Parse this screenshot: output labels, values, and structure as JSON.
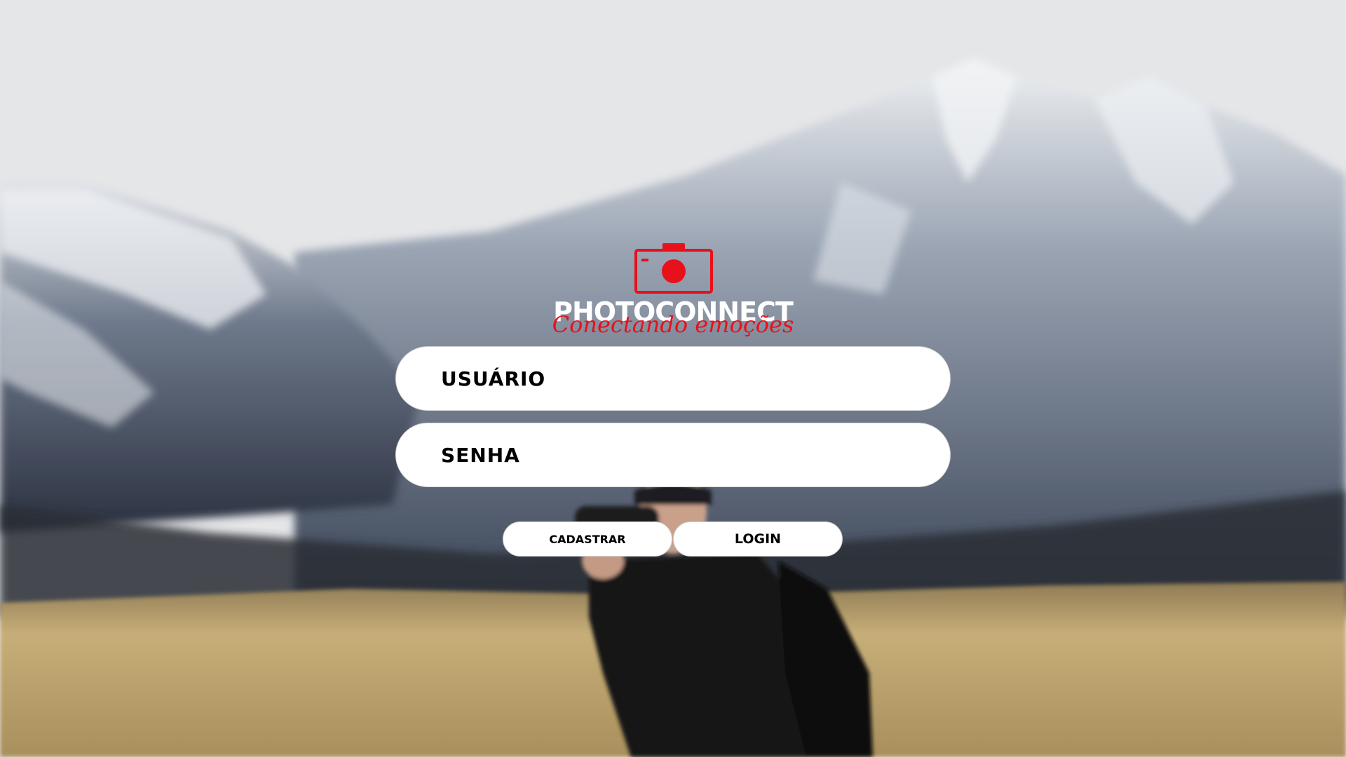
{
  "logo": {
    "title": "PHOTOCONNECT",
    "slogan": "Conectando emoções",
    "icon": "camera-icon",
    "accent_color": "#e8101a"
  },
  "form": {
    "username_placeholder": "USUÁRIO",
    "password_placeholder": "SENHA",
    "register_label": "CADASTRAR",
    "login_label": "LOGIN"
  },
  "background": {
    "description_icon": "mountain-landscape-photographer"
  }
}
